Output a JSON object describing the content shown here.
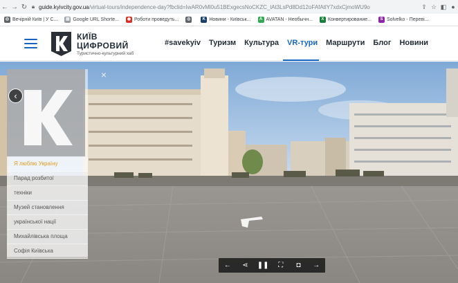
{
  "browser": {
    "url_host": "guide.kyivcity.gov.ua",
    "url_path": "/virtual-tours/independence-day?fbclid=IwAR0vMl0u51BExgecsNoCKZC_lAt3LsPd8Dd12oFAfAtlY7xdxCjmoWU9o"
  },
  "bookmarks": [
    {
      "label": "Вечірній Київ | У С...",
      "icon": "globe-icon",
      "color": "#5f6368"
    },
    {
      "label": "Google URL Shorte...",
      "icon": "file-icon",
      "color": "#5f6368"
    },
    {
      "label": "Роботи проведуть...",
      "icon": "news-icon",
      "color": "#d93025"
    },
    {
      "label": "",
      "icon": "globe-icon",
      "color": "#5f6368"
    },
    {
      "label": "Новини - Київськ...",
      "icon": "k-icon",
      "color": "#1a73e8"
    },
    {
      "label": "AVATAN - Необычн...",
      "icon": "avatan-icon",
      "color": "#34a853"
    },
    {
      "label": "Конвертирование...",
      "icon": "x-icon",
      "color": "#188038"
    },
    {
      "label": "Solvelko - Перевi...",
      "icon": "s-icon",
      "color": "#8e24aa"
    }
  ],
  "header": {
    "brand_line1": "КИЇВ",
    "brand_line2": "ЦИФРОВИЙ",
    "brand_subtitle": "Туристично-культурний хаб",
    "accent": "#1565c0",
    "menu": [
      {
        "label": "#savekyiv",
        "active": false
      },
      {
        "label": "Туризм",
        "active": false
      },
      {
        "label": "Культура",
        "active": false
      },
      {
        "label": "VR-тури",
        "active": true
      },
      {
        "label": "Маршрути",
        "active": false
      },
      {
        "label": "Блог",
        "active": false
      },
      {
        "label": "Новини",
        "active": false
      }
    ]
  },
  "panel": {
    "items": [
      {
        "label": "Я люблю Україну",
        "active": true
      },
      {
        "label": "Парад розбитої",
        "active": false
      },
      {
        "label": "техніки",
        "active": false
      },
      {
        "label": "Музей становлення",
        "active": false
      },
      {
        "label": "української нації",
        "active": false
      },
      {
        "label": "Михайлівська площа",
        "active": false
      },
      {
        "label": "Софія Київська",
        "active": false
      }
    ],
    "active_color": "#e69a1a"
  },
  "toolbar": {
    "buttons": [
      {
        "name": "prev-button",
        "glyph": "←"
      },
      {
        "name": "share-button",
        "glyph": "⋖"
      },
      {
        "name": "pause-button",
        "glyph": "❚❚"
      },
      {
        "name": "fullscreen-button",
        "glyph": "⛶"
      },
      {
        "name": "screenshot-button",
        "glyph": "◘"
      },
      {
        "name": "next-button",
        "glyph": "→"
      }
    ]
  }
}
